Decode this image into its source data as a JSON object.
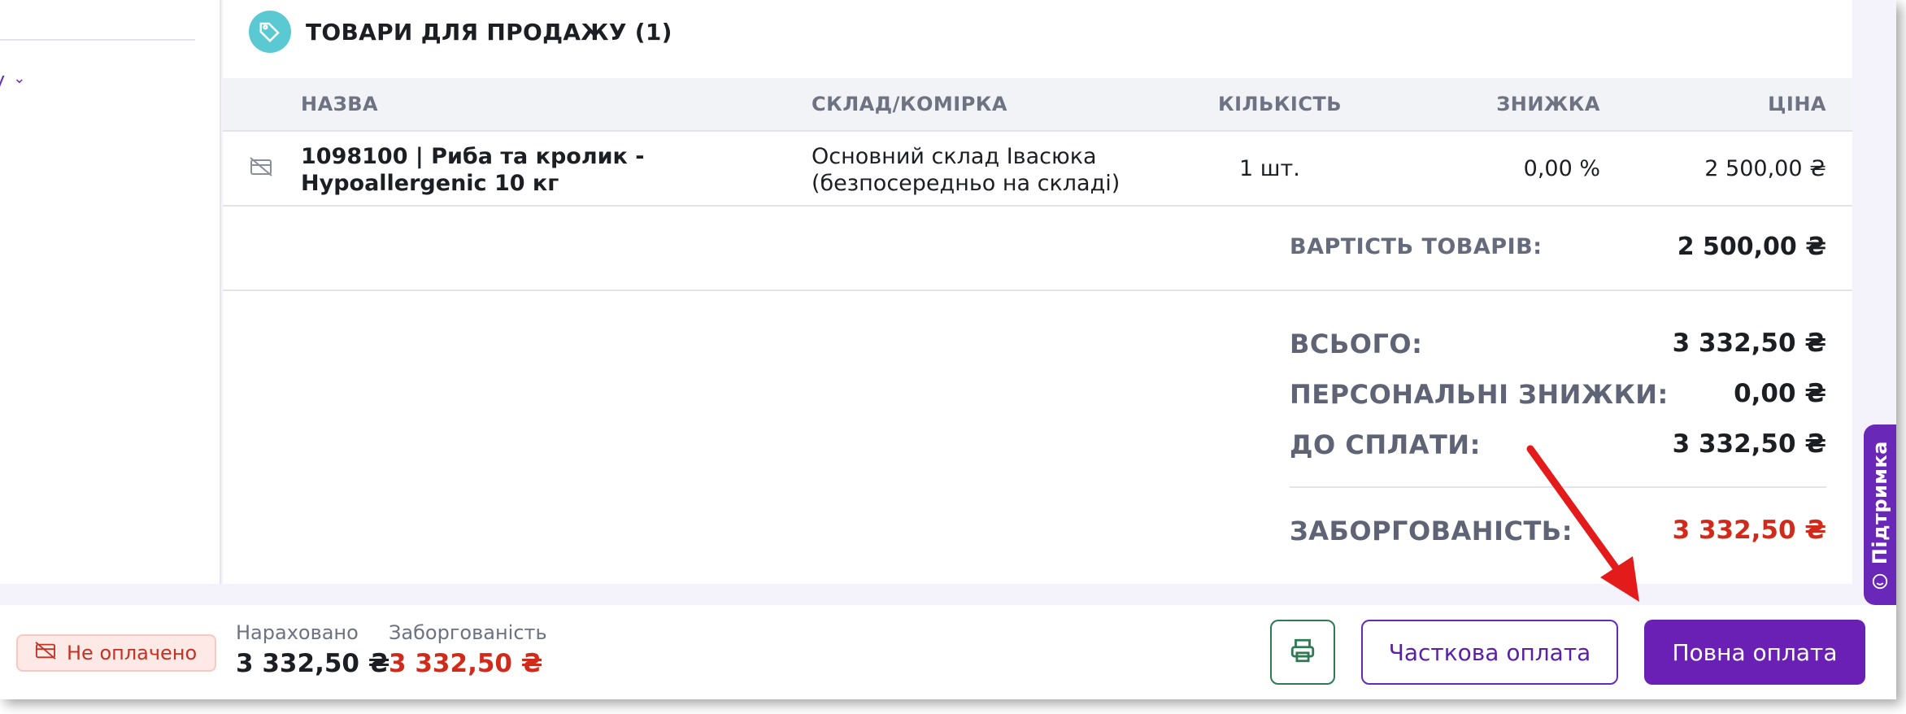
{
  "left": {
    "link_label": "у"
  },
  "section": {
    "title": "ТОВАРИ ДЛЯ ПРОДАЖУ (1)",
    "icon": "tag-icon"
  },
  "table": {
    "headers": {
      "name": "НАЗВА",
      "warehouse": "СКЛАД/КОМІРКА",
      "qty": "КІЛЬКІСТЬ",
      "discount": "ЗНИЖКА",
      "price": "ЦІНА"
    },
    "rows": [
      {
        "name_line1": "1098100 | Риба та кролик -",
        "name_line2": "Hypoallergenic 10 кг",
        "warehouse_line1": "Основний склад Івасюка",
        "warehouse_line2": "(безпосередньо на складі)",
        "qty": "1 шт.",
        "discount": "0,00 %",
        "price": "2 500,00 ₴"
      }
    ]
  },
  "goods_total": {
    "label": "ВАРТІСТЬ ТОВАРІВ:",
    "value": "2 500,00 ₴"
  },
  "totals": {
    "total_label": "ВСЬОГО:",
    "total_value": "3 332,50 ₴",
    "personal_label": "ПЕРСОНАЛЬНІ ЗНИЖКИ:",
    "personal_value": "0,00 ₴",
    "topay_label": "ДО СПЛАТИ:",
    "topay_value": "3 332,50 ₴",
    "debt_label": "ЗАБОРГОВАНІСТЬ:",
    "debt_value": "3 332,50 ₴"
  },
  "support": {
    "label": "Підтримка"
  },
  "bottom": {
    "status_badge": "Не оплачено",
    "accrued_label": "Нараховано",
    "accrued_value": "3 332,50 ₴",
    "debt_label": "Заборгованість",
    "debt_value": "3 332,50 ₴",
    "partial_button": "Часткова оплата",
    "full_button": "Повна оплата"
  },
  "colors": {
    "accent": "#6a20b5",
    "debt": "#d12a1b",
    "tag": "#5bc9d2",
    "print_border": "#2f7a52"
  }
}
